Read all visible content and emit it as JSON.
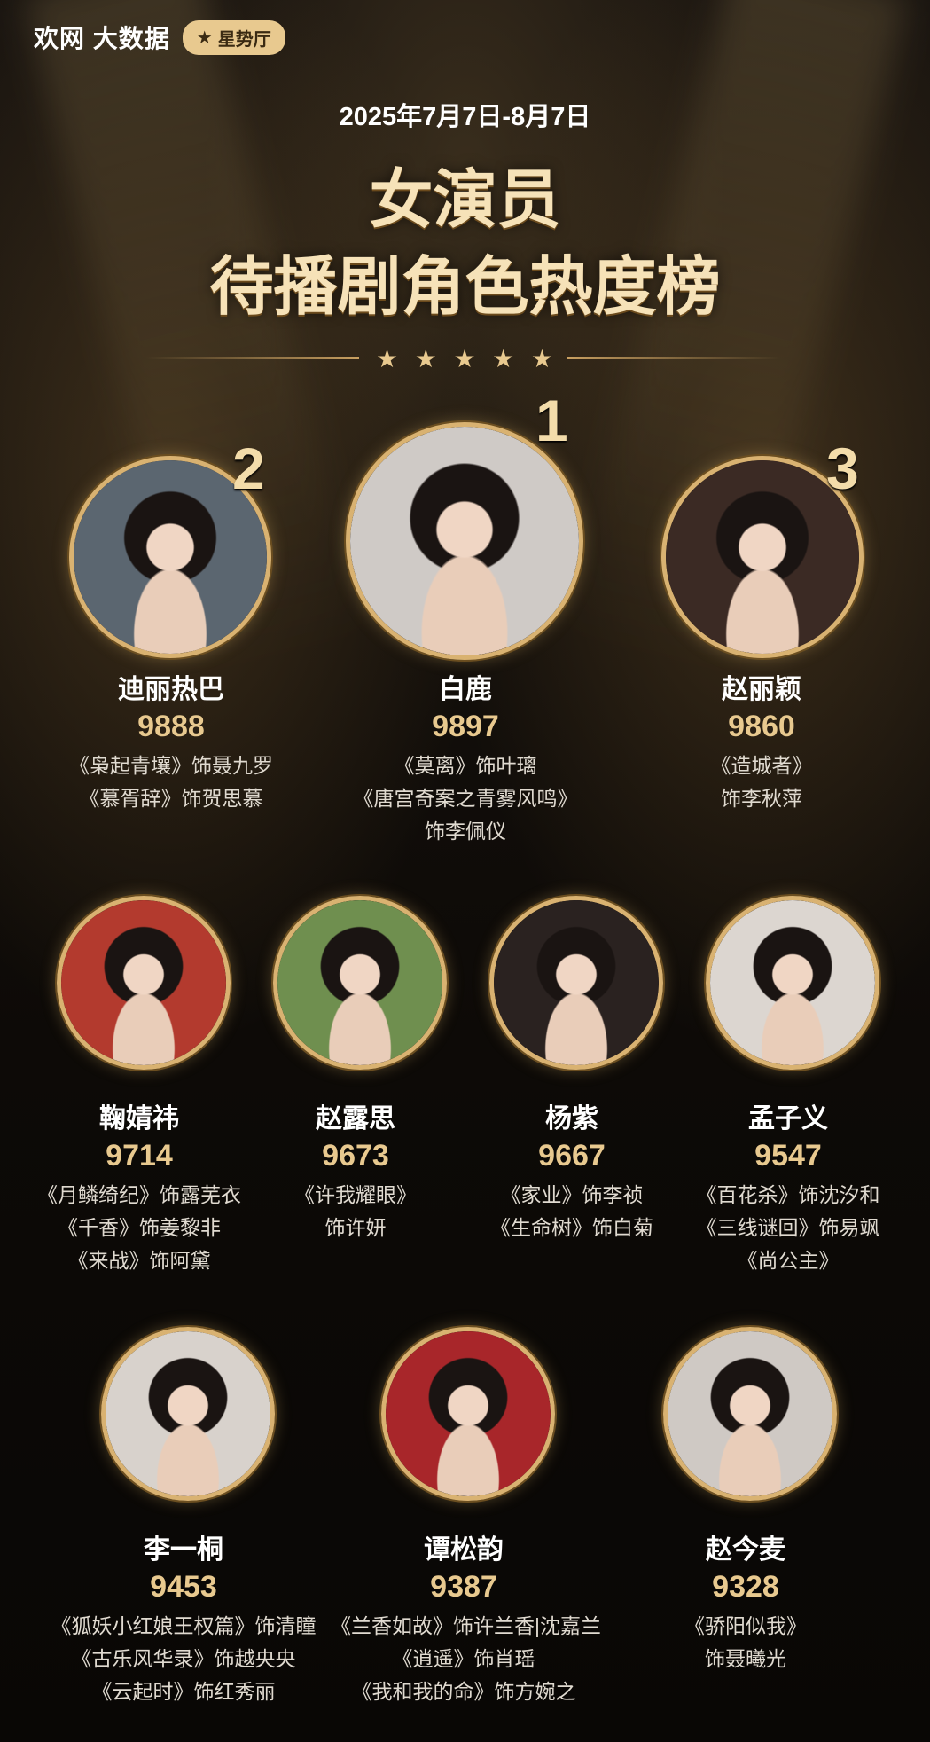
{
  "brand": {
    "logo": "欢网 大数据",
    "badge": "星势厅"
  },
  "header": {
    "dates": "2025年7月7日-8月7日",
    "title_line1": "女演员",
    "title_line2": "待播剧角色热度榜"
  },
  "actresses": [
    {
      "rank": "1",
      "name": "白鹿",
      "score": "9897",
      "roles": [
        "《莫离》饰叶璃",
        "《唐宫奇案之青雾风鸣》",
        "饰李佩仪"
      ],
      "bg": "#cfcac6"
    },
    {
      "rank": "2",
      "name": "迪丽热巴",
      "score": "9888",
      "roles": [
        "《枭起青壤》饰聂九罗",
        "《慕胥辞》饰贺思慕"
      ],
      "bg": "#5b6670"
    },
    {
      "rank": "3",
      "name": "赵丽颖",
      "score": "9860",
      "roles": [
        "《造城者》",
        "饰李秋萍"
      ],
      "bg": "#3b2a24"
    },
    {
      "name": "鞠婧祎",
      "score": "9714",
      "roles": [
        "《月鳞绮纪》饰露芜衣",
        "《千香》饰姜黎非",
        "《来战》饰阿黛"
      ],
      "bg": "#b33a2e"
    },
    {
      "name": "赵露思",
      "score": "9673",
      "roles": [
        "《许我耀眼》",
        "饰许妍"
      ],
      "bg": "#6f8f4f"
    },
    {
      "name": "杨紫",
      "score": "9667",
      "roles": [
        "《家业》饰李祯",
        "《生命树》饰白菊"
      ],
      "bg": "#2a2220"
    },
    {
      "name": "孟子义",
      "score": "9547",
      "roles": [
        "《百花杀》饰沈汐和",
        "《三线谜回》饰易飒",
        "《尚公主》"
      ],
      "bg": "#dcd6d0"
    },
    {
      "name": "李一桐",
      "score": "9453",
      "roles": [
        "《狐妖小红娘王权篇》饰清瞳",
        "《古乐风华录》饰越央央",
        "《云起时》饰红秀丽"
      ],
      "bg": "#d8d2cc"
    },
    {
      "name": "谭松韵",
      "score": "9387",
      "roles": [
        "《兰香如故》饰许兰香|沈嘉兰",
        "《逍遥》饰肖瑶",
        "《我和我的命》饰方婉之"
      ],
      "bg": "#a8262a"
    },
    {
      "name": "赵今麦",
      "score": "9328",
      "roles": [
        "《骄阳似我》",
        "饰聂曦光"
      ],
      "bg": "#cfc9c4"
    }
  ],
  "colors": {
    "gold": "#e8c98f",
    "ring": "#d9b271"
  }
}
